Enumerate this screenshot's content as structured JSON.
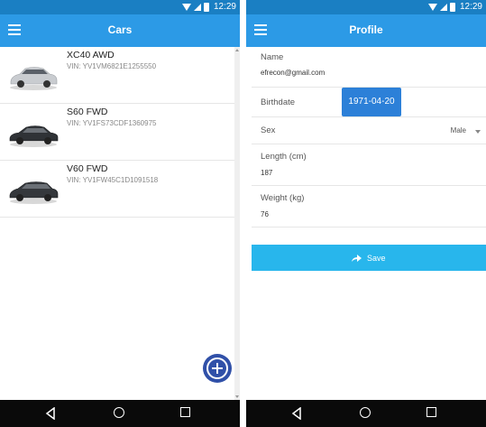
{
  "status_bar": {
    "time": "12:29"
  },
  "cars_screen": {
    "title": "Cars",
    "cars": [
      {
        "name": "XC40 AWD",
        "vin": "VIN: YV1VM6821E1255550",
        "image": "car-icon",
        "color": "#c9ccd0"
      },
      {
        "name": "S60 FWD",
        "vin": "VIN: YV1FS73CDF1360975",
        "image": "car-icon",
        "color": "#2f3236"
      },
      {
        "name": "V60 FWD",
        "vin": "VIN: YV1FW45C1D1091518",
        "image": "car-icon",
        "color": "#35383c"
      }
    ],
    "fab_icon": "plus-circle-icon"
  },
  "profile_screen": {
    "title": "Profile",
    "name_label": "Name",
    "name_value": "efrecon@gmail.com",
    "birthdate_label": "Birthdate",
    "birthdate_value": "1971-04-20",
    "sex_label": "Sex",
    "sex_value": "Male",
    "length_label": "Length (cm)",
    "length_value": "187",
    "weight_label": "Weight (kg)",
    "weight_value": "76",
    "save_label": "Save",
    "save_icon": "share-arrow-icon"
  },
  "colors": {
    "status_bar": "#1a7fc3",
    "app_bar": "#2c9ae6",
    "date_button": "#2c80d8",
    "save_button": "#28b6ec",
    "fab": "#3050a8",
    "nav_bar": "#0a0a0a"
  }
}
